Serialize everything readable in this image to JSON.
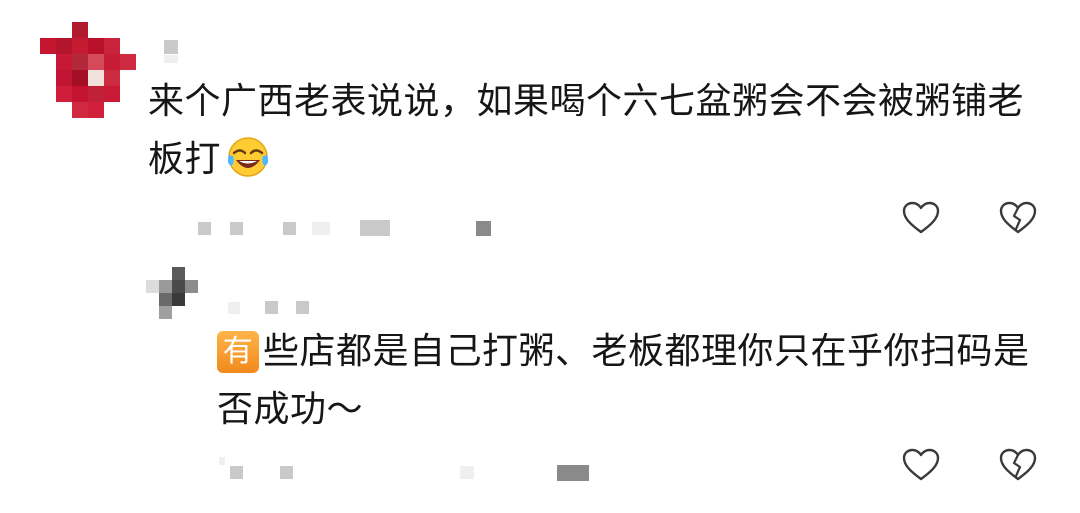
{
  "comment": {
    "text_line1": "来个广西老表说说，如果喝个六七盆粥会不会被粥铺老",
    "text_line2": "板打",
    "emoji": "face-with-tears-of-joy-icon",
    "like_icon": "heart-outline-icon",
    "dislike_icon": "broken-heart-icon"
  },
  "reply": {
    "badge": "有",
    "text_line1": "些店都是自己打粥、老板都理你只在乎你扫码是",
    "text_line2": "否成功～",
    "like_icon": "heart-outline-icon",
    "dislike_icon": "broken-heart-icon"
  },
  "colors": {
    "avatar_red": "#b4122f",
    "badge_orange": "#f59a23",
    "icon_gray": "#3a3a3a"
  }
}
